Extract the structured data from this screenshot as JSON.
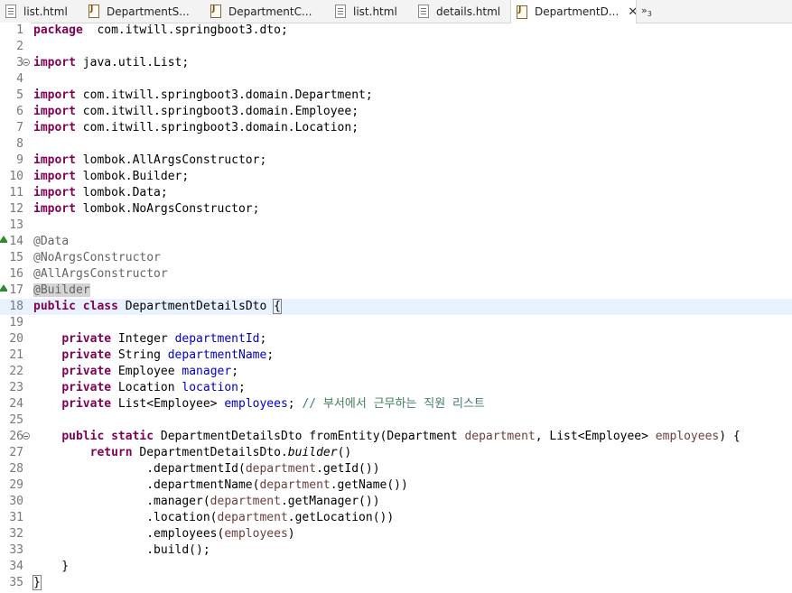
{
  "tabs": [
    {
      "label": "list.html",
      "type": "html"
    },
    {
      "label": "DepartmentS...",
      "type": "java"
    },
    {
      "label": "DepartmentC...",
      "type": "java"
    },
    {
      "label": "list.html",
      "type": "html"
    },
    {
      "label": "details.html",
      "type": "html"
    },
    {
      "label": "DepartmentD...",
      "type": "java",
      "active": true
    }
  ],
  "overflow": {
    "symbol": "»",
    "count": "3"
  },
  "editor": {
    "current_line": 18,
    "lines": [
      {
        "n": "1",
        "t": [
          [
            "kw",
            "package"
          ],
          [
            "",
            "  com.itwill.springboot3.dto;"
          ]
        ]
      },
      {
        "n": "2",
        "t": []
      },
      {
        "n": "3",
        "fold": true,
        "t": [
          [
            "kw",
            "import"
          ],
          [
            "",
            " java.util.List;"
          ]
        ]
      },
      {
        "n": "4",
        "t": []
      },
      {
        "n": "5",
        "t": [
          [
            "kw",
            "import"
          ],
          [
            "",
            " com.itwill.springboot3.domain.Department;"
          ]
        ]
      },
      {
        "n": "6",
        "t": [
          [
            "kw",
            "import"
          ],
          [
            "",
            " com.itwill.springboot3.domain.Employee;"
          ]
        ]
      },
      {
        "n": "7",
        "t": [
          [
            "kw",
            "import"
          ],
          [
            "",
            " com.itwill.springboot3.domain.Location;"
          ]
        ]
      },
      {
        "n": "8",
        "t": []
      },
      {
        "n": "9",
        "t": [
          [
            "kw",
            "import"
          ],
          [
            "",
            " lombok.AllArgsConstructor;"
          ]
        ]
      },
      {
        "n": "10",
        "t": [
          [
            "kw",
            "import"
          ],
          [
            "",
            " lombok.Builder;"
          ]
        ]
      },
      {
        "n": "11",
        "t": [
          [
            "kw",
            "import"
          ],
          [
            "",
            " lombok.Data;"
          ]
        ]
      },
      {
        "n": "12",
        "t": [
          [
            "kw",
            "import"
          ],
          [
            "",
            " lombok.NoArgsConstructor;"
          ]
        ]
      },
      {
        "n": "13",
        "t": []
      },
      {
        "n": "14",
        "marker": true,
        "t": [
          [
            "ann",
            "@Data"
          ]
        ]
      },
      {
        "n": "15",
        "t": [
          [
            "ann",
            "@NoArgsConstructor"
          ]
        ]
      },
      {
        "n": "16",
        "t": [
          [
            "ann",
            "@AllArgsConstructor"
          ]
        ]
      },
      {
        "n": "17",
        "marker": true,
        "t": [
          [
            "ann hl",
            "@Builder"
          ]
        ]
      },
      {
        "n": "18",
        "t": [
          [
            "kw",
            "public"
          ],
          [
            "",
            " "
          ],
          [
            "kw",
            "class"
          ],
          [
            "",
            " DepartmentDetailsDto "
          ],
          [
            "bracket",
            "{"
          ]
        ]
      },
      {
        "n": "19",
        "t": []
      },
      {
        "n": "20",
        "t": [
          [
            "",
            "    "
          ],
          [
            "kw",
            "private"
          ],
          [
            "",
            " Integer "
          ],
          [
            "fld",
            "departmentId"
          ],
          [
            "",
            ";"
          ]
        ]
      },
      {
        "n": "21",
        "t": [
          [
            "",
            "    "
          ],
          [
            "kw",
            "private"
          ],
          [
            "",
            " String "
          ],
          [
            "fld",
            "departmentName"
          ],
          [
            "",
            ";"
          ]
        ]
      },
      {
        "n": "22",
        "t": [
          [
            "",
            "    "
          ],
          [
            "kw",
            "private"
          ],
          [
            "",
            " Employee "
          ],
          [
            "fld",
            "manager"
          ],
          [
            "",
            ";"
          ]
        ]
      },
      {
        "n": "23",
        "t": [
          [
            "",
            "    "
          ],
          [
            "kw",
            "private"
          ],
          [
            "",
            " Location "
          ],
          [
            "fld",
            "location"
          ],
          [
            "",
            ";"
          ]
        ]
      },
      {
        "n": "24",
        "t": [
          [
            "",
            "    "
          ],
          [
            "kw",
            "private"
          ],
          [
            "",
            " List<Employee> "
          ],
          [
            "fld",
            "employees"
          ],
          [
            "",
            "; "
          ],
          [
            "cmt",
            "// 부서에서 근무하는 직원 리스트"
          ]
        ]
      },
      {
        "n": "25",
        "t": []
      },
      {
        "n": "26",
        "fold": true,
        "t": [
          [
            "",
            "    "
          ],
          [
            "kw",
            "public"
          ],
          [
            "",
            " "
          ],
          [
            "kw",
            "static"
          ],
          [
            "",
            " DepartmentDetailsDto fromEntity(Department "
          ],
          [
            "par",
            "department"
          ],
          [
            "",
            ", List<Employee> "
          ],
          [
            "par",
            "employees"
          ],
          [
            "",
            ") {"
          ]
        ]
      },
      {
        "n": "27",
        "t": [
          [
            "",
            "        "
          ],
          [
            "kw",
            "return"
          ],
          [
            "",
            " DepartmentDetailsDto."
          ],
          [
            "st",
            "builder"
          ],
          [
            "",
            "()"
          ]
        ]
      },
      {
        "n": "28",
        "t": [
          [
            "",
            "                .departmentId("
          ],
          [
            "par",
            "department"
          ],
          [
            "",
            ".getId())"
          ]
        ]
      },
      {
        "n": "29",
        "t": [
          [
            "",
            "                .departmentName("
          ],
          [
            "par",
            "department"
          ],
          [
            "",
            ".getName())"
          ]
        ]
      },
      {
        "n": "30",
        "t": [
          [
            "",
            "                .manager("
          ],
          [
            "par",
            "department"
          ],
          [
            "",
            ".getManager())"
          ]
        ]
      },
      {
        "n": "31",
        "t": [
          [
            "",
            "                .location("
          ],
          [
            "par",
            "department"
          ],
          [
            "",
            ".getLocation())"
          ]
        ]
      },
      {
        "n": "32",
        "t": [
          [
            "",
            "                .employees("
          ],
          [
            "par",
            "employees"
          ],
          [
            "",
            ")"
          ]
        ]
      },
      {
        "n": "33",
        "t": [
          [
            "",
            "                .build();"
          ]
        ]
      },
      {
        "n": "34",
        "t": [
          [
            "",
            "    }"
          ]
        ]
      },
      {
        "n": "35",
        "t": [
          [
            "bracket",
            "}"
          ]
        ]
      }
    ]
  },
  "colors": {
    "keyword": "#7f0055",
    "annotation": "#646464",
    "field": "#0000c0",
    "parameter": "#6a3e3e",
    "comment": "#3f7f5f",
    "current_line": "#e8f2fe"
  }
}
